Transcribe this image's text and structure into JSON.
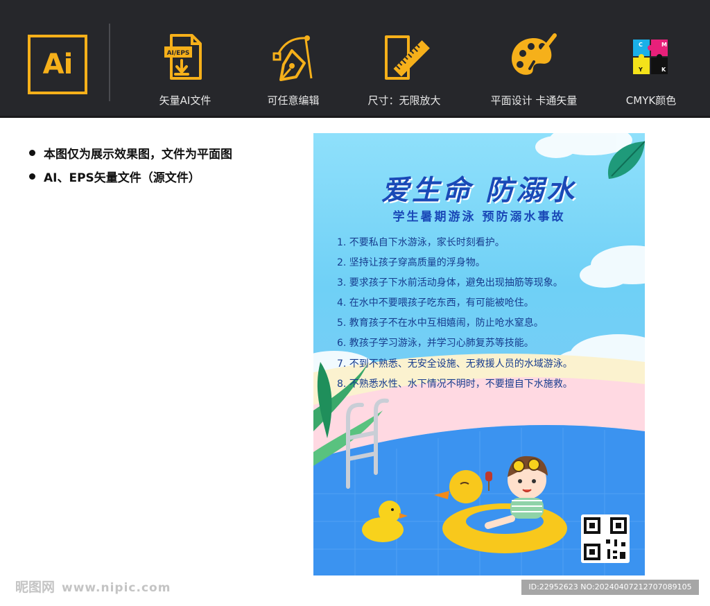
{
  "banner": {
    "logo_text": "Ai",
    "features": [
      {
        "icon": "ai-eps-file-download-icon",
        "label": "矢量AI文件",
        "badge": "AI/EPS"
      },
      {
        "icon": "pen-tool-icon",
        "label": "可任意编辑"
      },
      {
        "icon": "ruler-document-icon",
        "label": "尺寸：无限放大"
      },
      {
        "icon": "palette-brush-icon",
        "label": "平面设计  卡通矢量"
      },
      {
        "icon": "cmyk-puzzle-icon",
        "label": "CMYK颜色",
        "puzzle_letters": [
          "C",
          "M",
          "Y",
          "K"
        ]
      }
    ]
  },
  "bullets": [
    "本图仅为展示效果图，文件为平面图",
    "AI、EPS矢量文件（源文件）"
  ],
  "poster": {
    "title": "爱生命  防溺水",
    "subtitle": "学生暑期游泳 预防溺水事故",
    "rules": [
      "1. 不要私自下水游泳，家长时刻看护。",
      "2. 坚持让孩子穿高质量的浮身物。",
      "3. 要求孩子下水前活动身体，避免出现抽筋等现象。",
      "4. 在水中不要喂孩子吃东西，有可能被呛住。",
      "5. 教育孩子不在水中互相嬉闹，防止呛水窒息。",
      "6. 教孩子学习游泳，并学习心肺复苏等技能。",
      "7. 不到不熟悉、无安全设施、无救援人员的水域游泳。",
      "8. 不熟悉水性、水下情况不明时，不要擅自下水施救。"
    ]
  },
  "footer": {
    "watermark_cn": "昵图网",
    "watermark_site": "www.nipic.com",
    "id_text": "ID:22952623 NO:20240407212707089105"
  },
  "colors": {
    "banner_bg": "#26272b",
    "accent": "#f6b01a",
    "poster_title": "#1a49b7",
    "pool_blue": "#3b93f0",
    "duck_yellow": "#f8c81c"
  }
}
